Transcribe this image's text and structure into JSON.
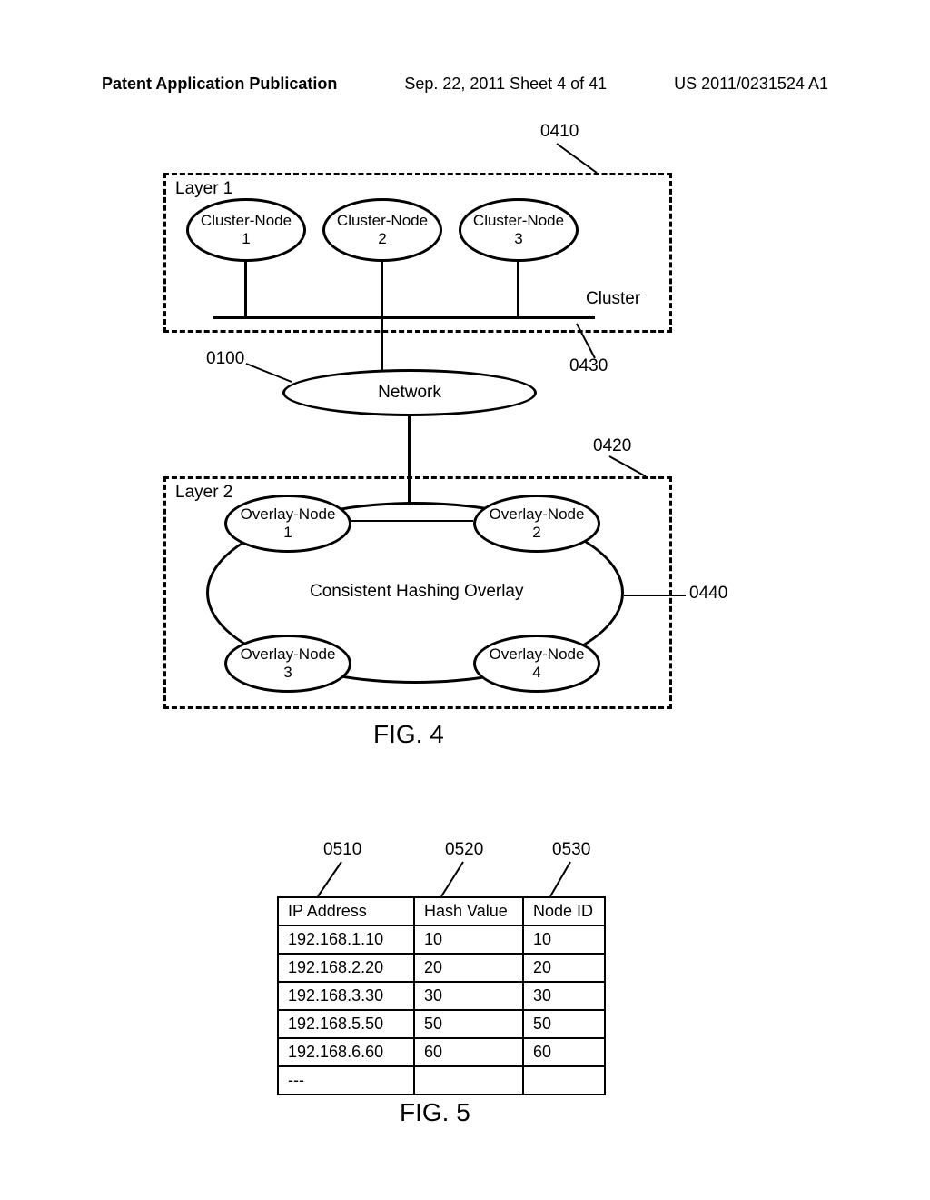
{
  "header": {
    "left": "Patent Application Publication",
    "center": "Sep. 22, 2011  Sheet 4 of 41",
    "right": "US 2011/0231524 A1"
  },
  "fig4": {
    "layer1_label": "Layer 1",
    "layer2_label": "Layer 2",
    "cluster_nodes": [
      "Cluster-Node\n1",
      "Cluster-Node\n2",
      "Cluster-Node\n3"
    ],
    "cluster_label": "Cluster",
    "network_label": "Network",
    "overlay_nodes": [
      "Overlay-Node\n1",
      "Overlay-Node\n2",
      "Overlay-Node\n3",
      "Overlay-Node\n4"
    ],
    "overlay_caption": "Consistent Hashing Overlay",
    "ref_0410": "0410",
    "ref_0430": "0430",
    "ref_0100": "0100",
    "ref_0420": "0420",
    "ref_0440": "0440",
    "caption": "FIG. 4"
  },
  "fig5": {
    "col_refs": {
      "ip": "0510",
      "hash": "0520",
      "node": "0530"
    },
    "headers": [
      "IP Address",
      "Hash Value",
      "Node ID"
    ],
    "rows": [
      {
        "ip": "192.168.1.10",
        "hash": "10",
        "node": "10"
      },
      {
        "ip": "192.168.2.20",
        "hash": "20",
        "node": "20"
      },
      {
        "ip": "192.168.3.30",
        "hash": "30",
        "node": "30"
      },
      {
        "ip": "192.168.5.50",
        "hash": "50",
        "node": "50"
      },
      {
        "ip": "192.168.6.60",
        "hash": "60",
        "node": "60"
      },
      {
        "ip": "---",
        "hash": "",
        "node": ""
      }
    ],
    "caption": "FIG. 5"
  }
}
